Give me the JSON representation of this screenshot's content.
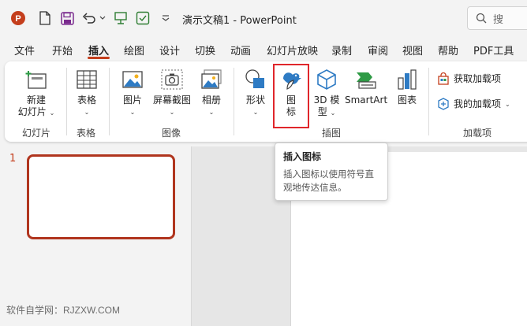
{
  "app": {
    "document_title": "演示文稿1",
    "app_name": "PowerPoint",
    "search_placeholder": "搜"
  },
  "tabs": [
    {
      "label": "文件"
    },
    {
      "label": "开始"
    },
    {
      "label": "插入",
      "active": true
    },
    {
      "label": "绘图"
    },
    {
      "label": "设计"
    },
    {
      "label": "切换"
    },
    {
      "label": "动画"
    },
    {
      "label": "幻灯片放映"
    },
    {
      "label": "录制"
    },
    {
      "label": "审阅"
    },
    {
      "label": "视图"
    },
    {
      "label": "帮助"
    },
    {
      "label": "PDF工具"
    }
  ],
  "ribbon": {
    "slides": {
      "new_slide_line1": "新建",
      "new_slide_line2": "幻灯片",
      "group_label": "幻灯片"
    },
    "tables": {
      "table": "表格",
      "group_label": "表格"
    },
    "images": {
      "picture": "图片",
      "screenshot": "屏幕截图",
      "album": "相册",
      "group_label": "图像"
    },
    "illustrations": {
      "shapes": "形状",
      "icons_line1": "图",
      "icons_line2": "标",
      "model3d_line1": "3D 模",
      "model3d_line2": "型",
      "smartart": "SmartArt",
      "chart": "图表",
      "group_label": "插图"
    },
    "addins": {
      "get_addins": "获取加载项",
      "my_addins": "我的加载项",
      "group_label": "加载项"
    }
  },
  "tooltip": {
    "title": "插入图标",
    "body": "插入图标以使用符号直观地传达信息。"
  },
  "slide_pane": {
    "slide_number": "1"
  },
  "watermark": "软件自学网：RJZXW.COM",
  "colors": {
    "accent": "#c43e1c",
    "highlight_box": "#e0262b",
    "ribbon_bg": "#ffffff",
    "window_bg": "#f3f3f3"
  }
}
